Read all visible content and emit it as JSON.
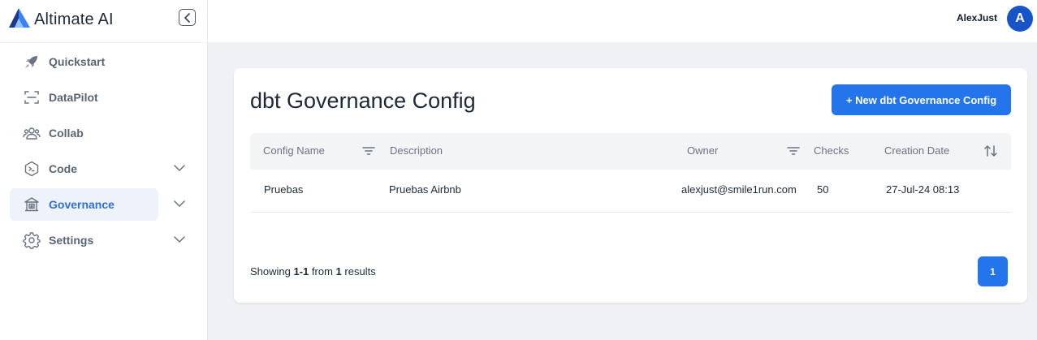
{
  "brand": {
    "name": "Altimate AI"
  },
  "sidebar": {
    "items": [
      {
        "label": "Quickstart",
        "icon": "rocket-icon",
        "expandable": false,
        "active": false
      },
      {
        "label": "DataPilot",
        "icon": "scan-icon",
        "expandable": false,
        "active": false
      },
      {
        "label": "Collab",
        "icon": "users-icon",
        "expandable": false,
        "active": false
      },
      {
        "label": "Code",
        "icon": "code-icon",
        "expandable": true,
        "active": false
      },
      {
        "label": "Governance",
        "icon": "bank-icon",
        "expandable": true,
        "active": true
      },
      {
        "label": "Settings",
        "icon": "gear-icon",
        "expandable": true,
        "active": false
      }
    ]
  },
  "header": {
    "username": "AlexJust",
    "avatar_initial": "A"
  },
  "page": {
    "title": "dbt Governance Config",
    "new_button_label": "+ New dbt Governance Config"
  },
  "table": {
    "columns": [
      "Config Name",
      "Description",
      "Owner",
      "Checks",
      "Creation Date"
    ],
    "rows": [
      {
        "config_name": "Pruebas",
        "description": "Pruebas Airbnb",
        "owner": "alexjust@smile1run.com",
        "checks": "50",
        "creation_date": "27-Jul-24 08:13"
      }
    ]
  },
  "pagination": {
    "prefix": "Showing",
    "range": "1-1",
    "middle": "from",
    "total": "1",
    "suffix": "results",
    "current_page": "1"
  },
  "colors": {
    "accent": "#2474ec",
    "avatar": "#1654c7",
    "active_nav_bg": "#eef3fb",
    "active_nav_text": "#2f6fd4",
    "page_bg": "#eff1f5"
  }
}
